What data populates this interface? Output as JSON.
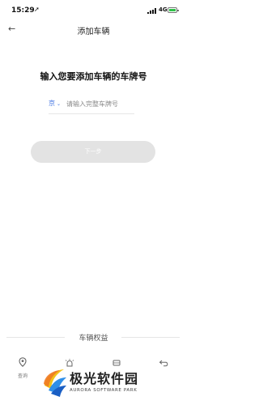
{
  "status_bar": {
    "time": "15:29",
    "location_glyph": "➚",
    "network": "4G",
    "icons": [
      "location-arrow-icon",
      "signal-icon",
      "battery-icon"
    ]
  },
  "nav": {
    "back_glyph": "←",
    "title": "添加车辆"
  },
  "main": {
    "heading": "输入您要添加车辆的车牌号",
    "province": "京",
    "province_chevron": "⌄",
    "plate_value": "",
    "plate_placeholder": "请输入完整车牌号",
    "next_label": "下一步"
  },
  "benefits": {
    "label": "车辆权益"
  },
  "tab_bar": {
    "tabs": [
      {
        "label": "查询",
        "icon": "location-pin-icon"
      },
      {
        "label": "",
        "icon": "alarm-light-icon"
      },
      {
        "label": "",
        "icon": "car-icon"
      },
      {
        "label": "",
        "icon": "return-icon"
      }
    ]
  },
  "watermark": {
    "text": "极光软件园",
    "subtext": "AURORA SOFTWARE PARK",
    "icon": "aurora-logo-icon"
  }
}
